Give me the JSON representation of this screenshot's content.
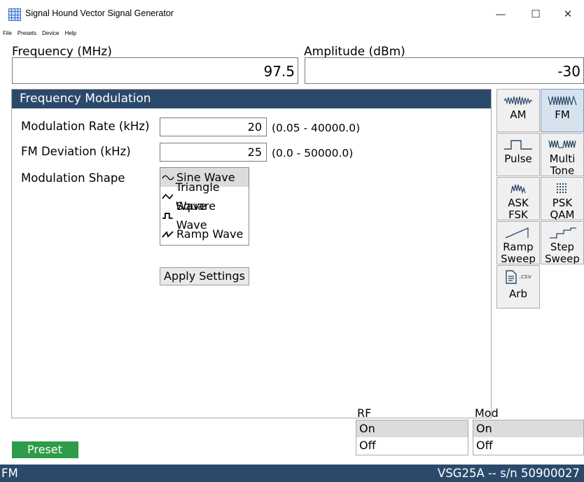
{
  "window": {
    "title": "Signal Hound Vector Signal Generator",
    "minimize": "—",
    "maximize": "☐",
    "close": "✕"
  },
  "menu": [
    "File",
    "Presets",
    "Device",
    "Help"
  ],
  "frequency": {
    "label": "Frequency (MHz)",
    "value": "97.5"
  },
  "amplitude": {
    "label": "Amplitude (dBm)",
    "value": "-30"
  },
  "panel": {
    "title": "Frequency Modulation",
    "rate": {
      "label": "Modulation Rate (kHz)",
      "value": "20",
      "range": "(0.05 - 40000.0)"
    },
    "deviation": {
      "label": "FM Deviation (kHz)",
      "value": "25",
      "range": "(0.0 - 50000.0)"
    },
    "shape": {
      "label": "Modulation Shape",
      "options": [
        "Sine Wave",
        "Triangle Wave",
        "Square Wave",
        "Ramp Wave"
      ],
      "selected": "Sine Wave"
    },
    "apply": "Apply Settings"
  },
  "mod_buttons": [
    {
      "label": "AM",
      "icon": "am-wave-icon",
      "active": false
    },
    {
      "label": "FM",
      "icon": "fm-wave-icon",
      "active": true
    },
    {
      "label": "Pulse",
      "icon": "pulse-icon",
      "active": false
    },
    {
      "label": "Multi Tone",
      "icon": "multi-tone-icon",
      "active": false
    },
    {
      "label": "ASK FSK",
      "icon": "ask-fsk-icon",
      "active": false
    },
    {
      "label": "PSK QAM",
      "icon": "psk-qam-icon",
      "active": false
    },
    {
      "label": "Ramp Sweep",
      "icon": "ramp-sweep-icon",
      "active": false
    },
    {
      "label": "Step Sweep",
      "icon": "step-sweep-icon",
      "active": false
    },
    {
      "label": "Arb",
      "icon": "csv-file-icon",
      "icon_text": ".csv",
      "active": false
    }
  ],
  "rf": {
    "label": "RF",
    "options": [
      "On",
      "Off"
    ],
    "selected": "On"
  },
  "mod": {
    "label": "Mod",
    "options": [
      "On",
      "Off"
    ],
    "selected": "On"
  },
  "preset": "Preset",
  "status": {
    "mode": "FM",
    "device": "VSG25A -- s/n 50900027"
  },
  "colors": {
    "header": "#2b4a6b",
    "preset": "#2e9c4a",
    "selected": "#dcdcdc"
  }
}
